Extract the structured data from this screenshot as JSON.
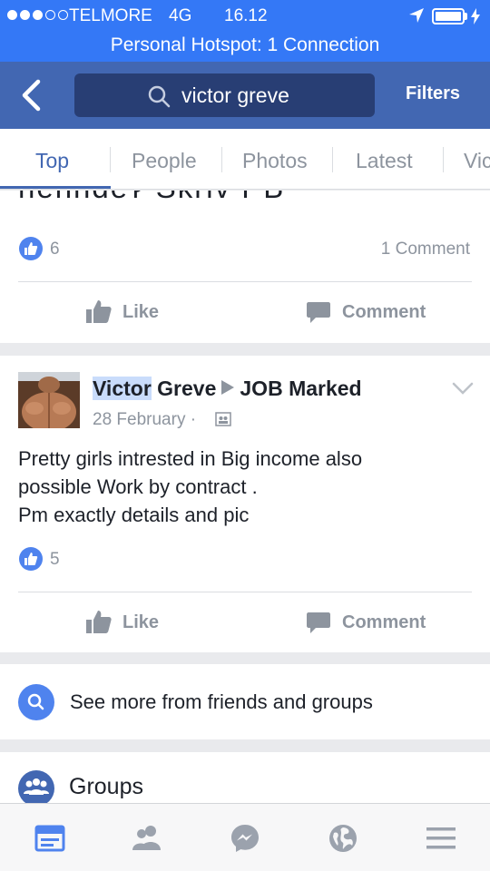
{
  "status_bar": {
    "carrier": "TELMORE",
    "network": "4G",
    "time": "16.12",
    "signal_dots_filled": 3,
    "signal_dots_total": 5
  },
  "hotspot_banner": "Personal Hotspot: 1 Connection",
  "nav": {
    "search_value": "victor greve",
    "filters_label": "Filters"
  },
  "tabs": [
    {
      "label": "Top",
      "active": true
    },
    {
      "label": "People",
      "active": false
    },
    {
      "label": "Photos",
      "active": false
    },
    {
      "label": "Latest",
      "active": false
    },
    {
      "label": "Vic",
      "active": false
    }
  ],
  "post1": {
    "cut_text": "nenndeʔ Skriv PB",
    "likes": "6",
    "comments": "1 Comment",
    "like_label": "Like",
    "comment_label": "Comment"
  },
  "post2": {
    "author_first": "Victor",
    "author_last": "Greve",
    "group": "JOB Marked",
    "date": "28 February",
    "separator": "·",
    "lines": [
      "Pretty girls intrested in Big income also",
      "possible Work by contract .",
      "Pm exactly details and pic"
    ],
    "likes": "5",
    "like_label": "Like",
    "comment_label": "Comment"
  },
  "see_more": "See more from friends and groups",
  "groups_section": "Groups",
  "colors": {
    "status_blue": "#3478f6",
    "nav_blue": "#4267b2",
    "search_bg": "#283e74",
    "like_blue": "#4f83ee",
    "gray_text": "#8d949e"
  },
  "bottom_icons": [
    "news-feed-icon",
    "friends-icon",
    "messenger-icon",
    "globe-icon",
    "menu-icon"
  ]
}
